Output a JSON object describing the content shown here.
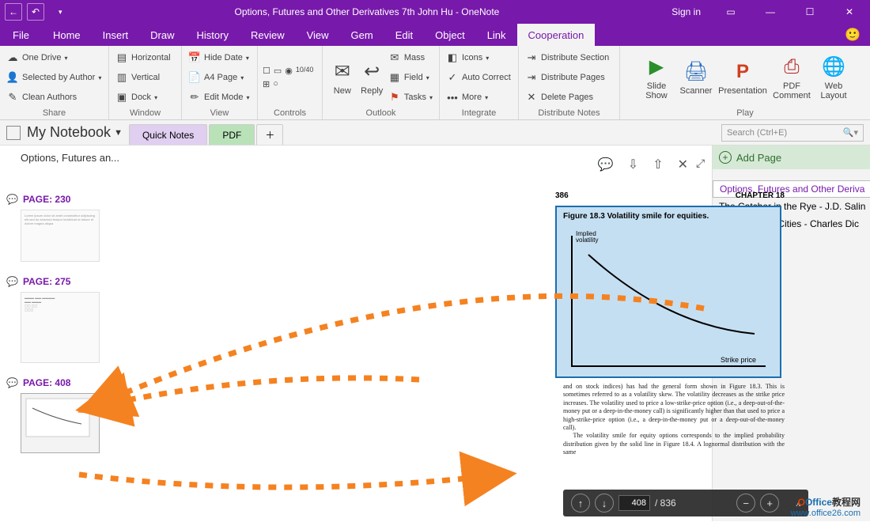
{
  "titlebar": {
    "title": "Options, Futures and Other Derivatives 7th John Hu - OneNote",
    "signin": "Sign in"
  },
  "tabs": {
    "file": "File",
    "list": [
      "Home",
      "Insert",
      "Draw",
      "History",
      "Review",
      "View",
      "Gem",
      "Edit",
      "Object",
      "Link"
    ],
    "active": "Cooperation"
  },
  "ribbon": {
    "share": {
      "label": "Share",
      "items": [
        "One Drive",
        "Selected by Author",
        "Clean Authors"
      ]
    },
    "window": {
      "label": "Window",
      "items": [
        "Horizontal",
        "Vertical",
        "Dock"
      ]
    },
    "view": {
      "label": "View",
      "items": [
        "Hide Date",
        "A4 Page",
        "Edit Mode"
      ]
    },
    "controls": {
      "label": "Controls"
    },
    "outlook": {
      "label": "Outlook",
      "new": "New",
      "reply": "Reply",
      "mass": "Mass",
      "field": "Field",
      "tasks": "Tasks"
    },
    "integrate": {
      "label": "Integrate",
      "icons": "Icons",
      "autocorrect": "Auto Correct",
      "more": "More"
    },
    "distribute": {
      "label": "Distribute Notes",
      "items": [
        "Distribute Section",
        "Distribute Pages",
        "Delete Pages"
      ]
    },
    "play": {
      "label": "Play",
      "slide": "Slide\nShow",
      "scanner": "Scanner",
      "presentation": "Presentation",
      "pdf": "PDF\nComment",
      "web": "Web\nLayout"
    }
  },
  "notebook": {
    "name": "My Notebook",
    "sectabs": {
      "quick": "Quick Notes",
      "pdf": "PDF"
    },
    "search": "Search (Ctrl+E)"
  },
  "leftpane": {
    "title": "Options, Futures an...",
    "pages": [
      {
        "label": "PAGE: 230"
      },
      {
        "label": "PAGE: 275"
      },
      {
        "label": "PAGE: 408"
      }
    ]
  },
  "doc": {
    "pagenum": "386",
    "chapter": "CHAPTER 18",
    "fig_caption": "Figure 18.3   Volatility smile for equities.",
    "ylabel": "Implied\nvolatility",
    "xlabel": "Strike price",
    "body": "and on stock indices) has had the general form shown in Figure 18.3. This is sometimes referred to as a volatility skew. The volatility decreases as the strike price increases. The volatility used to price a low-strike-price option (i.e., a deep-out-of-the-money put or a deep-in-the-money call) is significantly higher than that used to price a high-strike-price option (i.e., a deep-in-the-money put or a deep-out-of-the-money call).\n   The volatility smile for equity options corresponds to the implied probability distribution given by the solid line in Figure 18.4. A lognormal distribution with the same"
  },
  "pdfbar": {
    "page": "408",
    "total": "/ 836"
  },
  "rightpane": {
    "add": "Add Page",
    "pages": [
      "Options, Futures and Other Deriva",
      "The Catcher in the Rye - J.D. Salin",
      "A Tale of Two Cities - Charles Dic"
    ]
  },
  "watermark": {
    "brand1": "Office",
    "brand2": "教程网",
    "url": "www.office26.com"
  },
  "chart_data": {
    "type": "line",
    "title": "Figure 18.3 Volatility smile for equities.",
    "xlabel": "Strike price",
    "ylabel": "Implied volatility",
    "x": [
      0,
      1,
      2,
      3,
      4,
      5,
      6,
      7,
      8
    ],
    "values": [
      0.9,
      0.78,
      0.66,
      0.55,
      0.46,
      0.39,
      0.34,
      0.31,
      0.3
    ]
  }
}
